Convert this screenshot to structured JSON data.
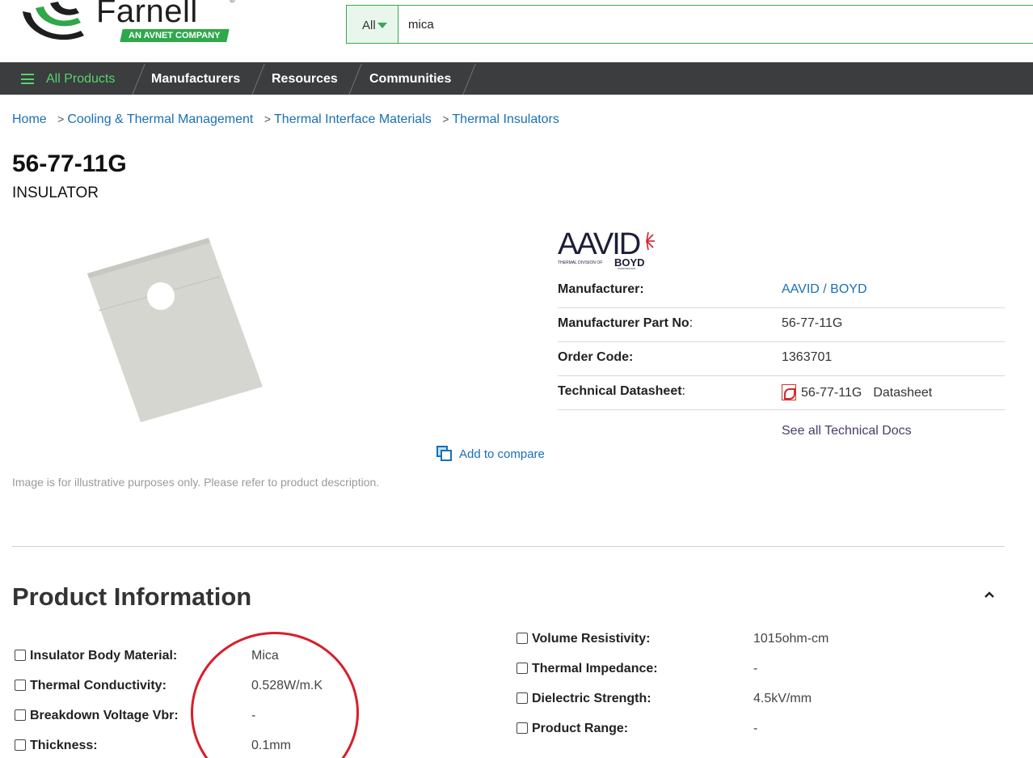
{
  "header": {
    "logo_text": "Farnell",
    "logo_reg": "®",
    "logo_tagline": "AN AVNET COMPANY",
    "search": {
      "category": "All",
      "value": "mica"
    }
  },
  "nav": {
    "items": [
      {
        "label": "All Products"
      },
      {
        "label": "Manufacturers"
      },
      {
        "label": "Resources"
      },
      {
        "label": "Communities"
      }
    ]
  },
  "breadcrumb": {
    "items": [
      "Home",
      "Cooling & Thermal Management",
      "Thermal Interface Materials",
      "Thermal Insulators"
    ],
    "separator": ">"
  },
  "product": {
    "title": "56-77-11G",
    "subtitle": "INSULATOR",
    "image_note": "Image is for illustrative purposes only. Please refer to product description.",
    "compare_label": "Add to compare",
    "brand_logo": {
      "name": "AAVID",
      "tagline": "THERMAL DIVISION OF",
      "parent": "BOYD",
      "parent_sub": "CORPORATION"
    }
  },
  "specs": {
    "manufacturer_label": "Manufacturer:",
    "manufacturer_value": "AAVID / BOYD",
    "part_no_label": "Manufacturer Part No",
    "part_no_colon": ":",
    "part_no_value": "56-77-11G",
    "order_code_label": "Order Code:",
    "order_code_value": "1363701",
    "datasheet_label": "Technical Datasheet",
    "datasheet_colon": ":",
    "datasheet_part": "56-77-11G",
    "datasheet_link": "Datasheet",
    "see_all": "See all Technical Docs"
  },
  "product_info": {
    "title": "Product Information",
    "left": [
      {
        "label": "Insulator Body Material:",
        "value": "Mica"
      },
      {
        "label": "Thermal Conductivity:",
        "value": "0.528W/m.K"
      },
      {
        "label": "Breakdown Voltage Vbr:",
        "value": "-"
      },
      {
        "label": "Thickness:",
        "value": "0.1mm"
      }
    ],
    "right": [
      {
        "label": "Volume Resistivity:",
        "value": "1015ohm-cm"
      },
      {
        "label": "Thermal Impedance:",
        "value": "-"
      },
      {
        "label": "Dielectric Strength:",
        "value": "4.5kV/mm"
      },
      {
        "label": "Product Range:",
        "value": "-"
      }
    ]
  },
  "colors": {
    "brand_green": "#2ea84a",
    "nav_bg": "#3b3d3e",
    "link_blue": "#1a6fb6",
    "annotation_red": "#d81e2a"
  }
}
